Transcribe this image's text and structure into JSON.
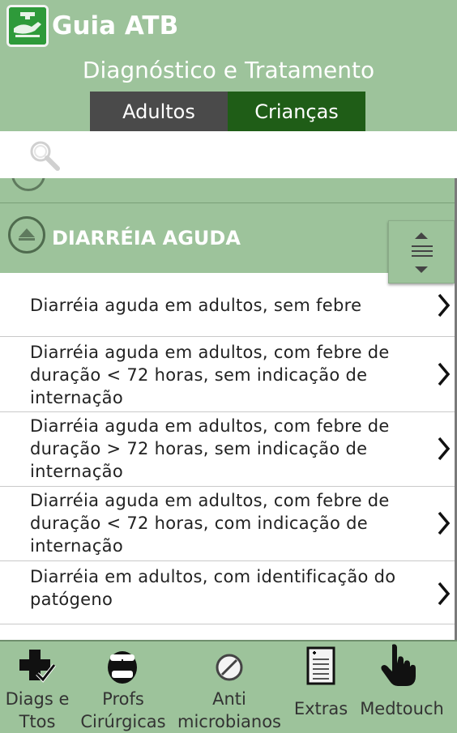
{
  "header": {
    "app_title": "Guia ATB",
    "subtitle": "Diagnóstico e Tratamento",
    "tabs": [
      {
        "label": "Adultos",
        "active": false
      },
      {
        "label": "Crianças",
        "active": true
      }
    ]
  },
  "search": {
    "placeholder": ""
  },
  "section": {
    "title": "DIARRÉIA AGUDA",
    "expanded": true
  },
  "items": [
    {
      "lines": [
        "Diarréia aguda em adultos, sem febre"
      ]
    },
    {
      "lines": [
        "Diarréia aguda em adultos, com febre de",
        "duração < 72 horas, sem indicação de",
        "internação"
      ]
    },
    {
      "lines": [
        "Diarréia aguda em adultos, com febre de",
        "duração > 72 horas, sem indicação de",
        "internação"
      ]
    },
    {
      "lines": [
        "Diarréia aguda em adultos, com febre de",
        "duração < 72 horas, com indicação de",
        "internação"
      ]
    },
    {
      "lines": [
        "Diarréia em adultos, com identificação do",
        "patógeno"
      ]
    }
  ],
  "bottom_nav": [
    {
      "icon": "medical-cross-check-icon",
      "lines": [
        "Diags e",
        "Ttos"
      ]
    },
    {
      "icon": "surgeon-icon",
      "lines": [
        "Profs",
        "Cirúrgicas"
      ]
    },
    {
      "icon": "antimicrobial-icon",
      "lines": [
        "Anti",
        "microbianos"
      ]
    },
    {
      "icon": "document-list-icon",
      "lines": [
        "Extras"
      ]
    },
    {
      "icon": "hand-pointer-icon",
      "lines": [
        "Medtouch"
      ]
    }
  ],
  "colors": {
    "header_bg": "#9dc39b",
    "tab_adultos": "#4a4a4a",
    "tab_criancas": "#1f5d17",
    "list_bg": "#ffffff"
  }
}
